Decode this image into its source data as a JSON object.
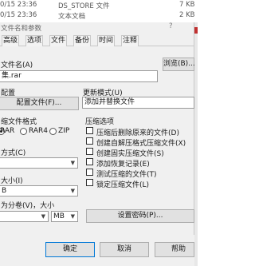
{
  "explorer": {
    "rows": [
      {
        "date": "0/15 23:36",
        "name": "DS_STORE 文件",
        "size": "7 KB"
      },
      {
        "date": "0/15 23:36",
        "name": "文本文档",
        "size": "2 KB"
      }
    ]
  },
  "dialog": {
    "title": "文件名和参数",
    "help": "?",
    "tabs": [
      "高级",
      "选项",
      "文件",
      "备份",
      "时间",
      "注释"
    ],
    "archive_name_label": "文件名(A)",
    "archive_name_value": "集.rar",
    "browse_label": "浏览(B)...",
    "profile_label": "配置",
    "profile_button": "配置文件(F)...",
    "update_mode_label": "更新模式(U)",
    "update_mode_value": "添加并替换文件",
    "format_label": "缩文件格式",
    "formats": [
      "RAR",
      "RAR4",
      "ZIP"
    ],
    "format_selected": "RAR",
    "archive_options_label": "压缩选项",
    "options": [
      "压缩后删除原来的文件(D)",
      "创建自解压格式压缩文件(X)",
      "创建固实压缩文件(S)",
      "添加恢复记录(E)",
      "测试压缩的文件(T)",
      "锁定压缩文件(L)"
    ],
    "method_label": "方式(C)",
    "method_value": "",
    "dict_label": "大小(I)",
    "dict_value": "B",
    "split_label": "为分卷(V)，大小",
    "split_unit": "MB",
    "set_password_button": "设置密码(P)...",
    "ok_button": "确定",
    "cancel_button": "取消",
    "help_button": "帮助"
  }
}
